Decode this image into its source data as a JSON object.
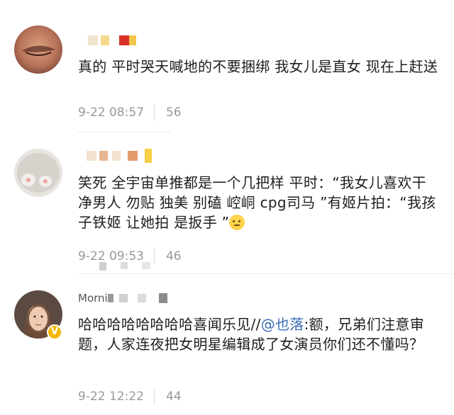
{
  "comments": [
    {
      "username": "",
      "text": "真的 平时哭天喊地的不要捆绑 我女儿是直女 现在上赶送",
      "time": "9-22 08:57",
      "likes": "56"
    },
    {
      "username": "",
      "text_a": "笑死 全宇宙单推都是一个几把样 平时：“我女儿喜欢干净男人 勿贴 独美 别磕 崆峒 cpg司马 ”有姬片拍：“我孩子铁姬 让她拍 是扳手 ”",
      "time": "9-22 09:53",
      "likes": "46"
    },
    {
      "username": "Morni",
      "text_before": "哈哈哈哈哈哈哈哈喜闻乐见//",
      "mention": "@也落",
      "text_after": ":额，兄弟们注意审题，人家连夜把女明星编辑成了女演员你们还不懂吗？",
      "time": "9-22 12:22",
      "likes": "44",
      "verified_badge": "V"
    }
  ],
  "icons": {
    "emoji": "thinking-face-emoji",
    "verified": "verified-v-badge"
  },
  "colors": {
    "mention": "#3a6bb5",
    "meta": "#999999",
    "badge": "#f5b700"
  }
}
